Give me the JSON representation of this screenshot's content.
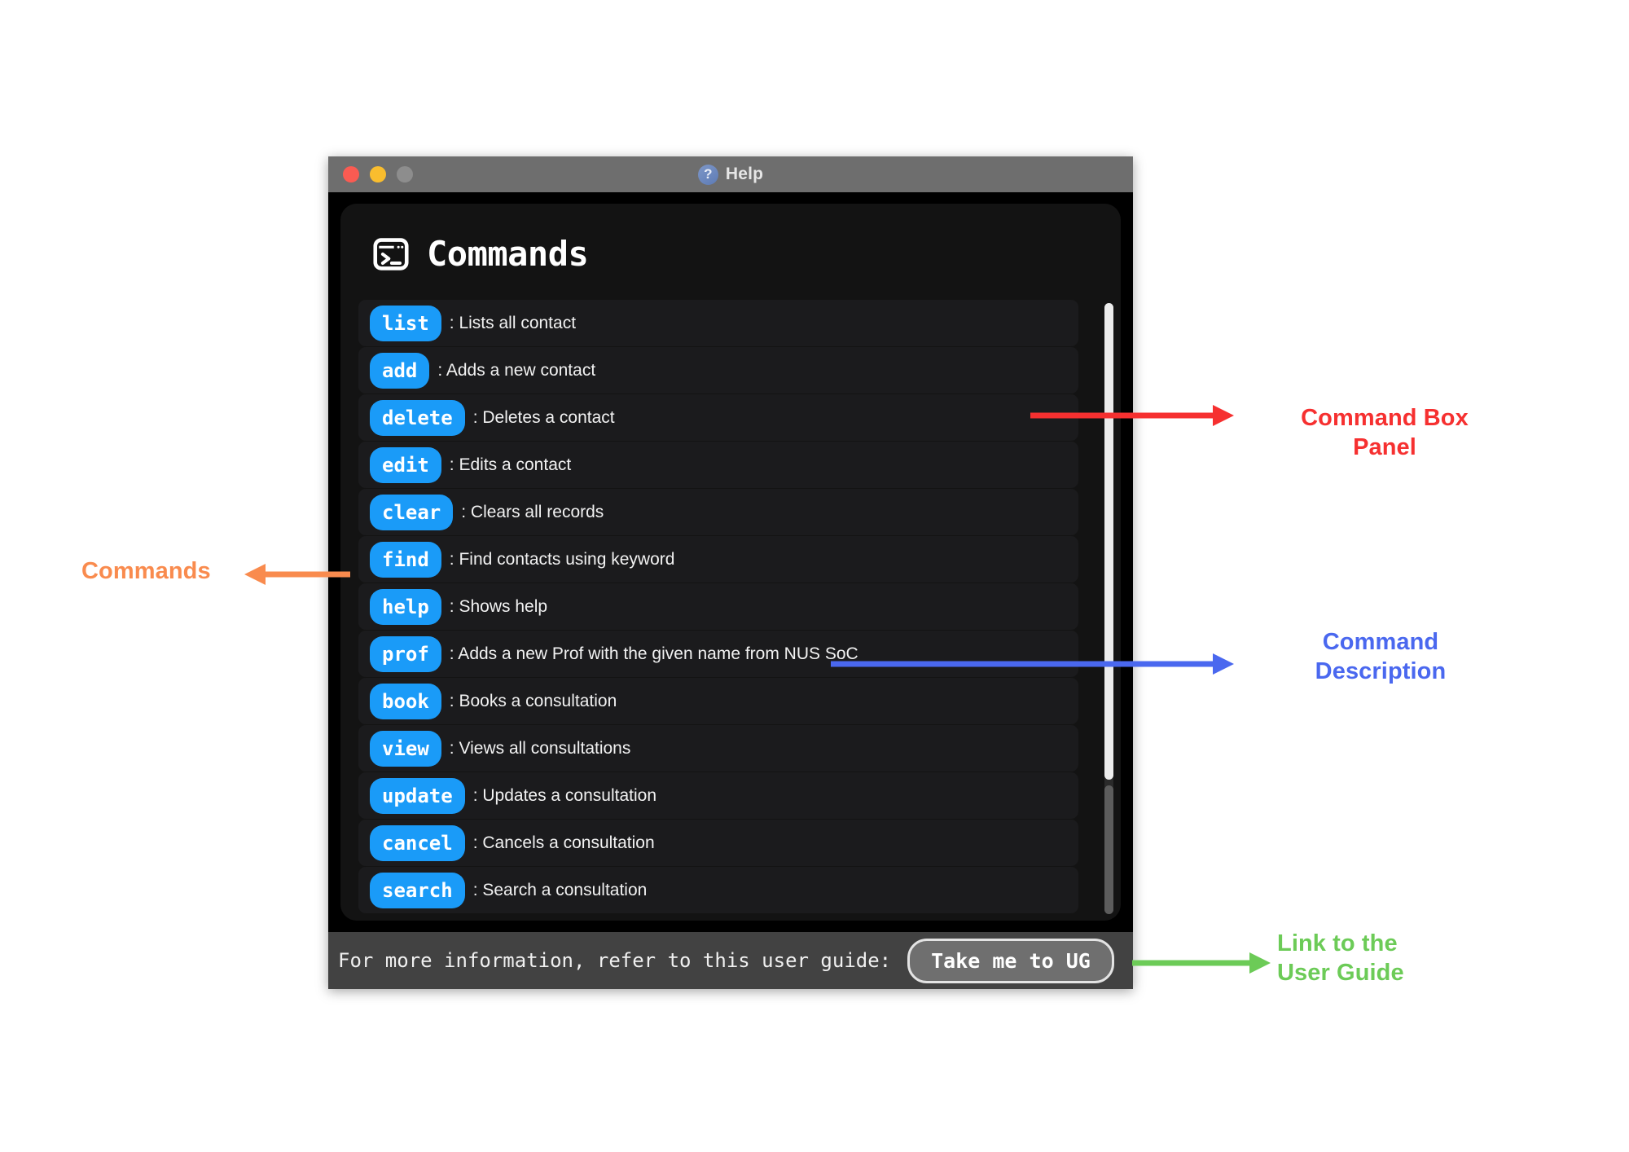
{
  "window": {
    "title": "Help",
    "help_icon": "question-mark-circle-icon",
    "traffic_lights": [
      "close-red",
      "minimize-yellow",
      "zoom-gray"
    ]
  },
  "panel": {
    "icon": "terminal-console-icon",
    "title": "Commands",
    "chip_color": "#1a9bf8",
    "background_color": "#131313"
  },
  "commands": [
    {
      "name": "list",
      "description": ": Lists all contact"
    },
    {
      "name": "add",
      "description": ": Adds a new contact"
    },
    {
      "name": "delete",
      "description": ": Deletes a contact"
    },
    {
      "name": "edit",
      "description": ": Edits a contact"
    },
    {
      "name": "clear",
      "description": ": Clears all records"
    },
    {
      "name": "find",
      "description": ": Find contacts using keyword"
    },
    {
      "name": "help",
      "description": ": Shows help"
    },
    {
      "name": "prof",
      "description": ": Adds a new Prof with the given name from NUS SoC"
    },
    {
      "name": "book",
      "description": ": Books a consultation"
    },
    {
      "name": "view",
      "description": ": Views all consultations"
    },
    {
      "name": "update",
      "description": ": Updates a consultation"
    },
    {
      "name": "cancel",
      "description": ": Cancels a consultation"
    },
    {
      "name": "search",
      "description": ": Search a consultation"
    }
  ],
  "footer": {
    "text": "For more information, refer to this user guide:",
    "button_label": "Take me to UG"
  },
  "annotations": {
    "command_box_panel": {
      "label": "Command Box\nPanel",
      "line1": "Command Box",
      "line2": "Panel",
      "color": "#f63030"
    },
    "command_description": {
      "label": "Command\nDescription",
      "line1": "Command",
      "line2": "Description",
      "color": "#4a68ef"
    },
    "user_guide_link": {
      "label": "Link to the\nUser Guide",
      "line1": "Link to the",
      "line2": "User Guide",
      "color": "#6ccb57"
    },
    "commands": {
      "label": "Commands",
      "color": "#f98b4e"
    }
  }
}
